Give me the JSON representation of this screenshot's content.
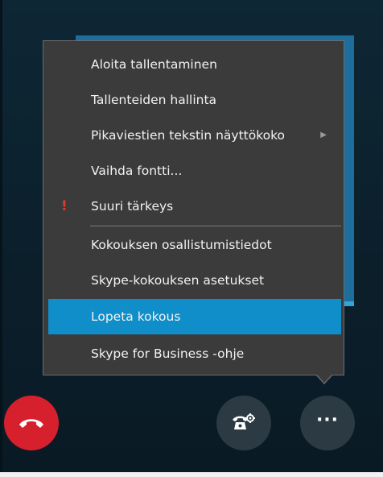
{
  "menu": {
    "items": [
      {
        "label": "Aloita tallentaminen",
        "has_submenu": false,
        "important": false,
        "highlighted": false
      },
      {
        "label": "Tallenteiden hallinta",
        "has_submenu": false,
        "important": false,
        "highlighted": false
      },
      {
        "label": "Pikaviestien tekstin näyttökoko",
        "has_submenu": true,
        "important": false,
        "highlighted": false
      },
      {
        "label": "Vaihda fontti...",
        "has_submenu": false,
        "important": false,
        "highlighted": false
      },
      {
        "label": "Suuri tärkeys",
        "has_submenu": false,
        "important": true,
        "highlighted": false
      },
      {
        "label": "Kokouksen osallistumistiedot",
        "has_submenu": false,
        "important": false,
        "highlighted": false
      },
      {
        "label": "Skype-kokouksen asetukset",
        "has_submenu": false,
        "important": false,
        "highlighted": false
      },
      {
        "label": "Lopeta kokous",
        "has_submenu": false,
        "important": false,
        "highlighted": true
      },
      {
        "label": "Skype for Business -ohje",
        "has_submenu": false,
        "important": false,
        "highlighted": false
      }
    ],
    "important_glyph": "!",
    "submenu_glyph": "▶"
  },
  "controls": {
    "hangup_icon": "phone-hangup-icon",
    "dialpad_icon": "phone-settings-icon",
    "more_icon": "more-options-icon",
    "more_glyph": "···"
  },
  "colors": {
    "menu_bg": "#3b3b3b",
    "highlight": "#0f8ec9",
    "hangup": "#d6202e",
    "important": "#e03a2b"
  }
}
